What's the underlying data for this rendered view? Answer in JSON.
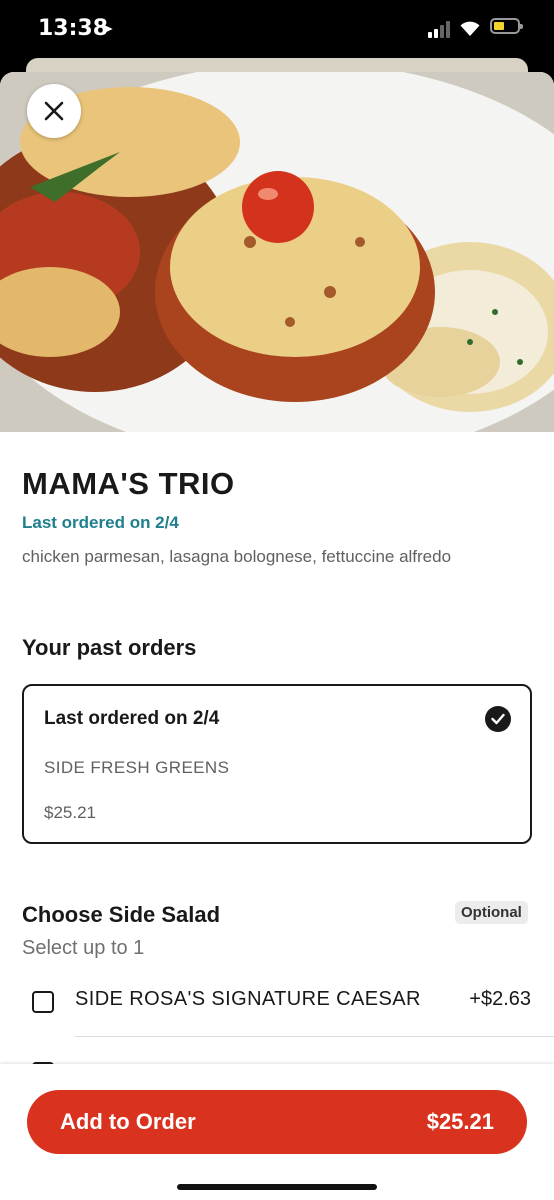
{
  "status_bar": {
    "time": "13:38",
    "location_arrow": "location-arrow-icon",
    "battery_color": "#f2d22c"
  },
  "hero": {
    "image": "food-photo",
    "close_icon": "close-icon"
  },
  "item": {
    "title": "MAMA'S TRIO",
    "last_ordered": "Last ordered on 2/4",
    "description": "chicken parmesan, lasagna bolognese, fettuccine alfredo",
    "accent_color": "#1f7f8c"
  },
  "past_orders": {
    "heading": "Your past orders",
    "order": {
      "title": "Last ordered on 2/4",
      "item": "SIDE FRESH GREENS",
      "price": "$25.21",
      "selected": true
    }
  },
  "side_salad": {
    "heading": "Choose Side Salad",
    "badge": "Optional",
    "subheading": "Select up to 1",
    "options": [
      {
        "label": "SIDE ROSA'S SIGNATURE CAESAR",
        "price": "+$2.63",
        "checked": false
      }
    ]
  },
  "cta": {
    "label": "Add to Order",
    "price": "$25.21",
    "color": "#d9321e"
  }
}
